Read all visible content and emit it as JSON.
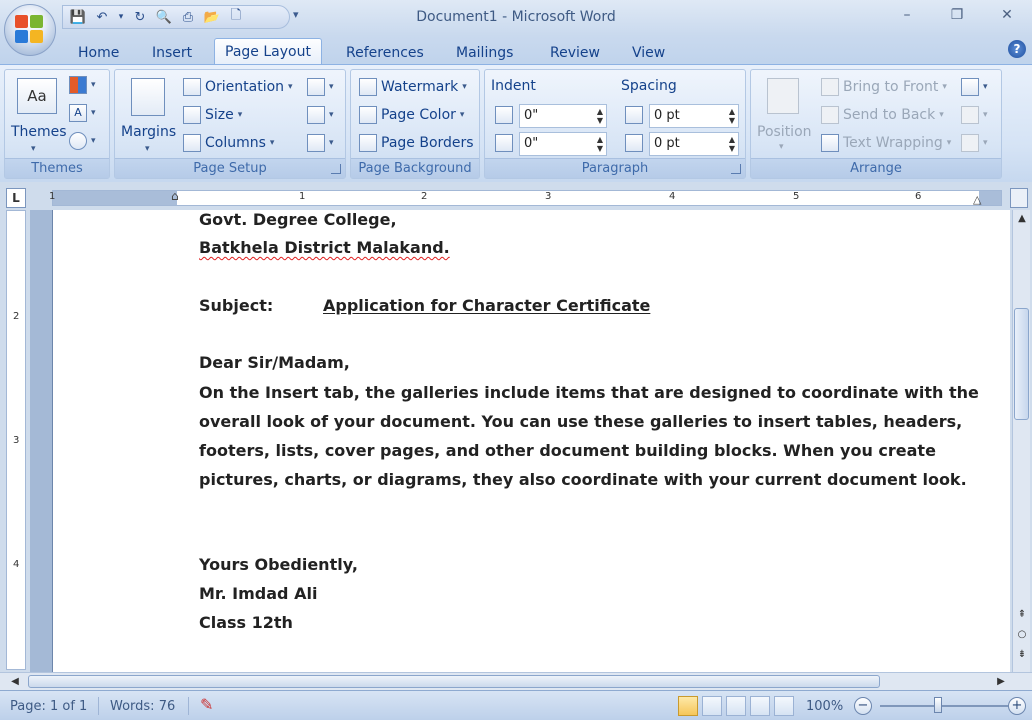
{
  "window": {
    "title": "Document1 - Microsoft Word",
    "minimize": "–",
    "restore": "❐",
    "close": "✕"
  },
  "qat": {
    "more": "▾"
  },
  "tabs": [
    "Home",
    "Insert",
    "Page Layout",
    "References",
    "Mailings",
    "Review",
    "View"
  ],
  "active_tab": "Page Layout",
  "ribbon": {
    "themes": {
      "group_label": "Themes",
      "themes_button": "Themes"
    },
    "page_setup": {
      "group_label": "Page Setup",
      "margins": "Margins",
      "orientation": "Orientation",
      "size": "Size",
      "columns": "Columns"
    },
    "page_background": {
      "group_label": "Page Background",
      "watermark": "Watermark",
      "page_color": "Page Color",
      "page_borders": "Page Borders"
    },
    "paragraph": {
      "group_label": "Paragraph",
      "indent_label": "Indent",
      "spacing_label": "Spacing",
      "indent_left": "0\"",
      "indent_right": "0\"",
      "spacing_before": "0 pt",
      "spacing_after": "0 pt"
    },
    "arrange": {
      "group_label": "Arrange",
      "position": "Position",
      "bring_to_front": "Bring to Front",
      "send_to_back": "Send to Back",
      "text_wrapping": "Text Wrapping"
    }
  },
  "ruler": {
    "numbers": [
      "1",
      "1",
      "2",
      "3",
      "4",
      "5",
      "6"
    ],
    "vnumbers": [
      "2",
      "3",
      "4"
    ]
  },
  "document": {
    "line1": "Govt. Degree College,",
    "line2": "Batkhela District Malakand.",
    "subject_label": "Subject:",
    "subject_text": "Application for Character Certificate",
    "salutation": "Dear Sir/Madam,",
    "body": "On the Insert tab, the galleries include items that are designed to coordinate with the overall look of your document. You can use these galleries to insert tables, headers, footers, lists, cover pages, and other document building blocks. When you create pictures, charts, or diagrams, they also coordinate with your current document look.",
    "closing": "Yours Obediently,",
    "name": "Mr. Imdad Ali",
    "class": "Class 12th"
  },
  "status": {
    "page": "Page: 1 of 1",
    "words": "Words: 76",
    "zoom": "100%"
  },
  "colors": {
    "ribbon_text": "#15428b",
    "spell_error": "#e02020",
    "active_view": "#f6c65a"
  }
}
